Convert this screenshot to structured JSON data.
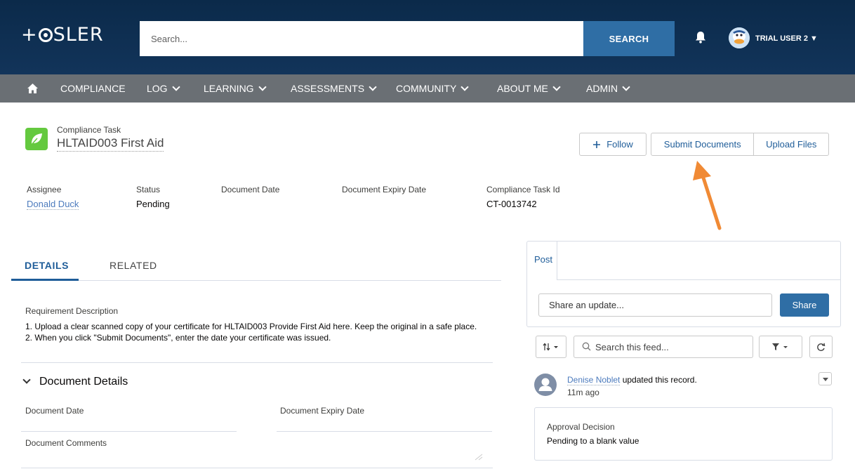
{
  "header": {
    "logo_text_prefix": "+",
    "logo_text_suffix": "SLER",
    "search_placeholder": "Search...",
    "search_button": "SEARCH",
    "user_name": "TRIAL USER 2 ▼"
  },
  "nav": {
    "items": [
      {
        "label": "COMPLIANCE"
      },
      {
        "label": "LOG"
      },
      {
        "label": "LEARNING"
      },
      {
        "label": "ASSESSMENTS"
      },
      {
        "label": "COMMUNITY"
      },
      {
        "label": "ABOUT ME"
      },
      {
        "label": "ADMIN"
      }
    ]
  },
  "record": {
    "type": "Compliance Task",
    "title": "HLTAID003 First Aid",
    "buttons": {
      "follow": "Follow",
      "submit": "Submit Documents",
      "upload": "Upload Files"
    },
    "fields": [
      {
        "label": "Assignee",
        "value": "Donald Duck"
      },
      {
        "label": "Status",
        "value": "Pending"
      },
      {
        "label": "Document Date",
        "value": ""
      },
      {
        "label": "Document Expiry Date",
        "value": ""
      },
      {
        "label": "Compliance Task Id",
        "value": "CT-0013742"
      }
    ]
  },
  "tabs": {
    "details": "DETAILS",
    "related": "RELATED"
  },
  "details": {
    "requirement_label": "Requirement Description",
    "requirement_lines": [
      "1. Upload a clear scanned copy of your certificate for HLTAID003 Provide First Aid here. Keep the original in a safe place.",
      "2. When you click \"Submit Documents\", enter the date your certificate was issued."
    ],
    "section_title": "Document Details",
    "document_date_label": "Document Date",
    "document_expiry_label": "Document Expiry Date",
    "document_comments_label": "Document Comments"
  },
  "feed": {
    "post_tab": "Post",
    "share_placeholder": "Share an update...",
    "share_button": "Share",
    "search_placeholder": "Search this feed...",
    "item": {
      "actor": "Denise Noblet",
      "action": " updated this record.",
      "time": "11m ago",
      "change_label": "Approval Decision",
      "change_value": "Pending to a blank value"
    }
  },
  "colors": {
    "header_bg": "#0b2a4a",
    "nav_bg": "#6a6f74",
    "brand_blue": "#2f6ea5",
    "link_blue": "#1f5d99",
    "object_icon_green": "#64c93f",
    "annotation_arrow": "#f08a35"
  },
  "icons": {
    "bell": "bell-icon",
    "home": "home-icon",
    "object": "leaf-icon",
    "plus": "plus-icon",
    "sort": "sort-icon",
    "search": "search-icon",
    "filter": "filter-icon",
    "refresh": "refresh-icon",
    "user": "user-icon"
  }
}
